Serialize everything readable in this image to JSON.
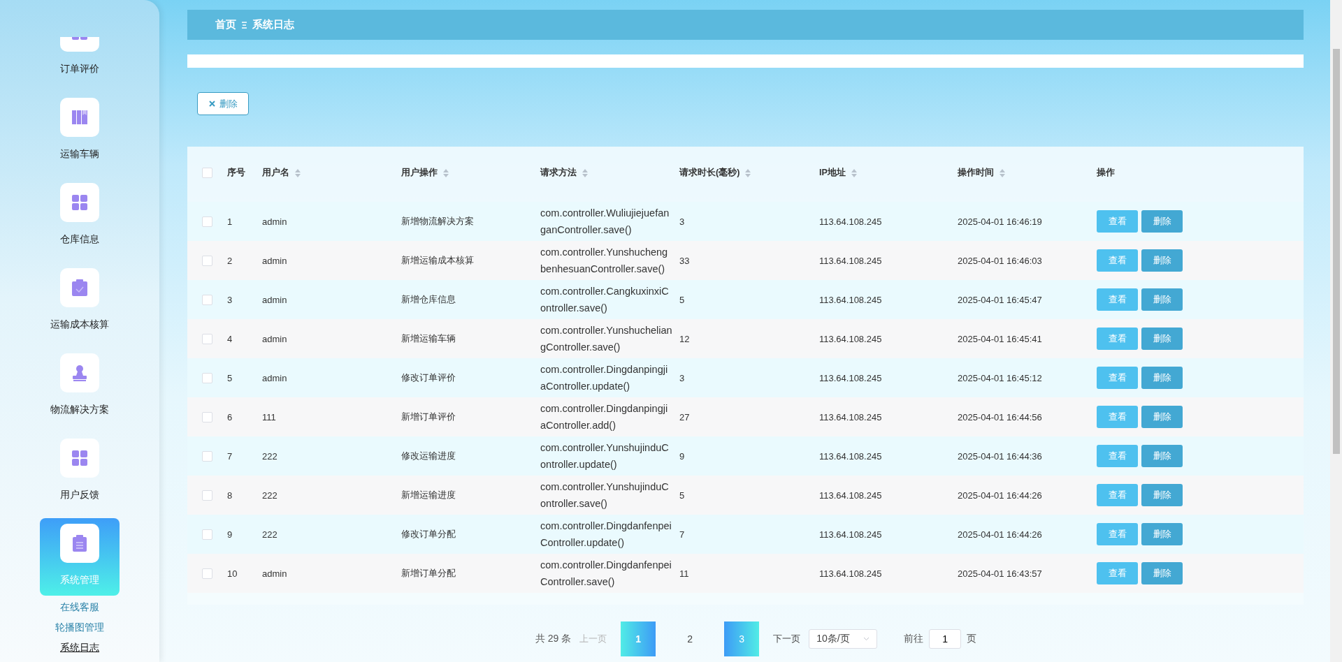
{
  "sidebar": {
    "items": [
      {
        "label": "订单评价",
        "selected": false
      },
      {
        "label": "运输车辆",
        "selected": false
      },
      {
        "label": "仓库信息",
        "selected": false
      },
      {
        "label": "运输成本核算",
        "selected": false
      },
      {
        "label": "物流解决方案",
        "selected": false
      },
      {
        "label": "用户反馈",
        "selected": false
      },
      {
        "label": "系统管理",
        "selected": true,
        "children": [
          {
            "label": "在线客服",
            "selected": false
          },
          {
            "label": "轮播图管理",
            "selected": false
          },
          {
            "label": "系统日志",
            "selected": true
          }
        ]
      }
    ]
  },
  "breadcrumb": {
    "home": "首页",
    "current": "系统日志"
  },
  "toolbar": {
    "delete_button": "删除"
  },
  "table": {
    "columns": [
      {
        "label": "序号",
        "sortable": false
      },
      {
        "label": "用户名",
        "sortable": true
      },
      {
        "label": "用户操作",
        "sortable": true
      },
      {
        "label": "请求方法",
        "sortable": true
      },
      {
        "label": "请求时长(毫秒)",
        "sortable": true
      },
      {
        "label": "IP地址",
        "sortable": true
      },
      {
        "label": "操作时间",
        "sortable": true
      },
      {
        "label": "操作",
        "sortable": false
      }
    ],
    "all_checked": false,
    "rows": [
      {
        "checked": false,
        "cells": [
          "1",
          "admin",
          "新增物流解决方案",
          "com.controller.WuliujiejuefanganController.save()",
          "3",
          "113.64.108.245",
          "2025-04-01 16:46:19"
        ],
        "actions": [
          "查看",
          "删除"
        ]
      },
      {
        "checked": false,
        "cells": [
          "2",
          "admin",
          "新增运输成本核算",
          "com.controller.YunshuchengbenhesuanController.save()",
          "33",
          "113.64.108.245",
          "2025-04-01 16:46:03"
        ],
        "actions": [
          "查看",
          "删除"
        ]
      },
      {
        "checked": false,
        "cells": [
          "3",
          "admin",
          "新增仓库信息",
          "com.controller.CangkuxinxiController.save()",
          "5",
          "113.64.108.245",
          "2025-04-01 16:45:47"
        ],
        "actions": [
          "查看",
          "删除"
        ]
      },
      {
        "checked": false,
        "cells": [
          "4",
          "admin",
          "新增运输车辆",
          "com.controller.YunshucheliangController.save()",
          "12",
          "113.64.108.245",
          "2025-04-01 16:45:41"
        ],
        "actions": [
          "查看",
          "删除"
        ]
      },
      {
        "checked": false,
        "cells": [
          "5",
          "admin",
          "修改订单评价",
          "com.controller.DingdanpingjiaController.update()",
          "3",
          "113.64.108.245",
          "2025-04-01 16:45:12"
        ],
        "actions": [
          "查看",
          "删除"
        ]
      },
      {
        "checked": false,
        "cells": [
          "6",
          "111",
          "新增订单评价",
          "com.controller.DingdanpingjiaController.add()",
          "27",
          "113.64.108.245",
          "2025-04-01 16:44:56"
        ],
        "actions": [
          "查看",
          "删除"
        ]
      },
      {
        "checked": false,
        "cells": [
          "7",
          "222",
          "修改运输进度",
          "com.controller.YunshujinduController.update()",
          "9",
          "113.64.108.245",
          "2025-04-01 16:44:36"
        ],
        "actions": [
          "查看",
          "删除"
        ]
      },
      {
        "checked": false,
        "cells": [
          "8",
          "222",
          "新增运输进度",
          "com.controller.YunshujinduController.save()",
          "5",
          "113.64.108.245",
          "2025-04-01 16:44:26"
        ],
        "actions": [
          "查看",
          "删除"
        ]
      },
      {
        "checked": false,
        "cells": [
          "9",
          "222",
          "修改订单分配",
          "com.controller.DingdanfenpeiController.update()",
          "7",
          "113.64.108.245",
          "2025-04-01 16:44:26"
        ],
        "actions": [
          "查看",
          "删除"
        ]
      },
      {
        "checked": false,
        "cells": [
          "10",
          "admin",
          "新增订单分配",
          "com.controller.DingdanfenpeiController.save()",
          "11",
          "113.64.108.245",
          "2025-04-01 16:43:57"
        ],
        "actions": [
          "查看",
          "删除"
        ]
      }
    ]
  },
  "pagination": {
    "total": "共 29 条",
    "prev": {
      "label": "上一页",
      "disabled": true
    },
    "pages": [
      {
        "label": "1",
        "selected": true,
        "hovered": false
      },
      {
        "label": "2",
        "selected": false,
        "hovered": false
      },
      {
        "label": "3",
        "selected": false,
        "hovered": true
      }
    ],
    "next": {
      "label": "下一页",
      "disabled": false
    },
    "page_size": "10条/页",
    "goto_label": "前往",
    "goto_value": "1",
    "goto_suffix": "页"
  }
}
